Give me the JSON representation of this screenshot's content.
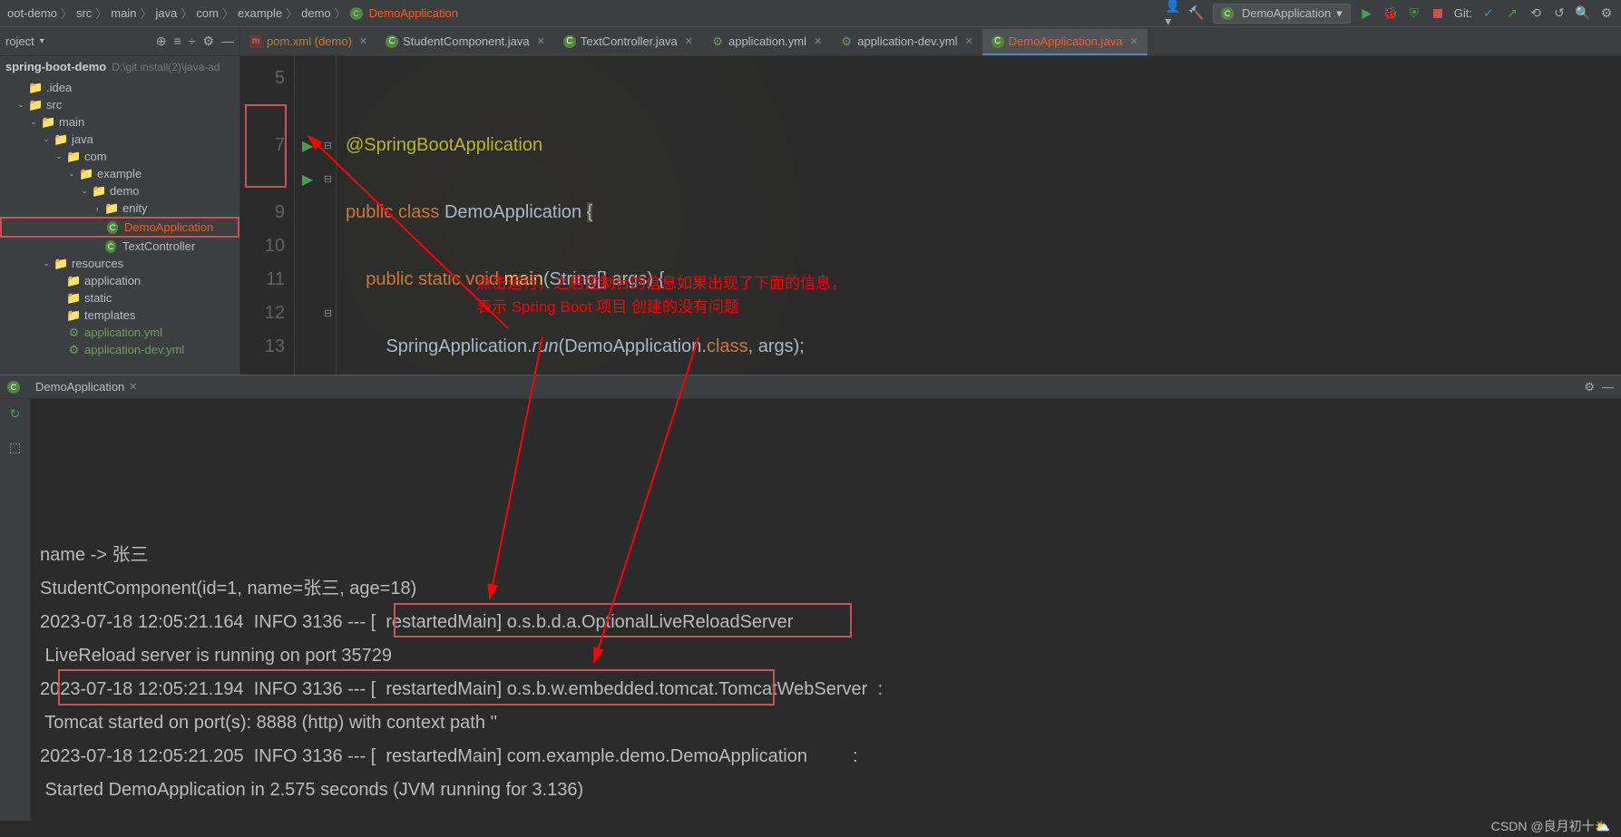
{
  "breadcrumb": [
    "oot-demo",
    "src",
    "main",
    "java",
    "com",
    "example",
    "demo"
  ],
  "breadcrumb_active": "DemoApplication",
  "runcfg_label": "DemoApplication",
  "git_label": "Git:",
  "proj_panel_label": "roject",
  "root_name": "spring-boot-demo",
  "root_path": "D:\\git install(2)\\java-ad",
  "tree": [
    {
      "indent": 1,
      "icon": "folder",
      "name": ".idea",
      "exp": ""
    },
    {
      "indent": 1,
      "icon": "folder-src",
      "name": "src",
      "exp": "v"
    },
    {
      "indent": 2,
      "icon": "folder",
      "name": "main",
      "exp": "v"
    },
    {
      "indent": 3,
      "icon": "folder-src",
      "name": "java",
      "exp": "v"
    },
    {
      "indent": 4,
      "icon": "folder-src",
      "name": "com",
      "exp": "v"
    },
    {
      "indent": 5,
      "icon": "folder-src",
      "name": "example",
      "exp": "v"
    },
    {
      "indent": 6,
      "icon": "folder-src",
      "name": "demo",
      "exp": "v"
    },
    {
      "indent": 7,
      "icon": "folder-src",
      "name": "enity",
      "exp": ">"
    },
    {
      "indent": 7,
      "icon": "class",
      "name": "DemoApplication",
      "highlight": true,
      "sel": true
    },
    {
      "indent": 7,
      "icon": "class",
      "name": "TextController"
    },
    {
      "indent": 3,
      "icon": "folder",
      "name": "resources",
      "exp": "v"
    },
    {
      "indent": 4,
      "icon": "folder",
      "name": "application"
    },
    {
      "indent": 4,
      "icon": "folder",
      "name": "static"
    },
    {
      "indent": 4,
      "icon": "folder",
      "name": "templates"
    },
    {
      "indent": 4,
      "icon": "yml",
      "name": "application.yml",
      "res": true
    },
    {
      "indent": 4,
      "icon": "yml",
      "name": "application-dev.yml",
      "res": true
    }
  ],
  "tabs": [
    {
      "icon": "m",
      "name": "pom.xml (demo)",
      "cls": "red"
    },
    {
      "icon": "c",
      "name": "StudentComponent.java"
    },
    {
      "icon": "c",
      "name": "TextController.java"
    },
    {
      "icon": "y",
      "name": "application.yml"
    },
    {
      "icon": "y",
      "name": "application-dev.yml"
    },
    {
      "icon": "c",
      "name": "DemoApplication.java",
      "active": true
    }
  ],
  "gutter_lines": [
    "5",
    "",
    "7",
    "",
    "9",
    "10",
    "11",
    "12",
    "13"
  ],
  "code_annotation": "@SpringBootApplication",
  "code_kw_public": "public",
  "code_kw_class": "class",
  "code_cls_demo": "DemoApplication",
  "code_kw_static": "static",
  "code_kw_void": "void",
  "code_mtd_main": "main",
  "code_sig": "(String[] args) {",
  "code_run_call": "SpringApplication.",
  "code_run_mtd": "run",
  "code_run_args": "(DemoApplication.",
  "code_kw_class2": "class",
  "code_run_tail": ", args);",
  "code_brace_open": "{",
  "code_brace_close": "}",
  "annotation_line1": "点击运行，之后控制台的信息如果出现了下面的信息，",
  "annotation_line2": "表示 Spring Boot 项目 创建的没有问题",
  "runtab_name": "DemoApplication",
  "console_lines": [
    "name -> 张三",
    "StudentComponent(id=1, name=张三, age=18)",
    "",
    "2023-07-18 12:05:21.164  INFO 3136 --- [  restartedMain] o.s.b.d.a.OptionalLiveReloadServer",
    " LiveReload server is running on port 35729",
    "2023-07-18 12:05:21.194  INFO 3136 --- [  restartedMain] o.s.b.w.embedded.tomcat.TomcatWebServer  :",
    " Tomcat started on port(s): 8888 (http) with context path ''",
    "2023-07-18 12:05:21.205  INFO 3136 --- [  restartedMain] com.example.demo.DemoApplication         :",
    " Started DemoApplication in 2.575 seconds (JVM running for 3.136)"
  ],
  "watermark": "CSDN @良月初十⛅"
}
